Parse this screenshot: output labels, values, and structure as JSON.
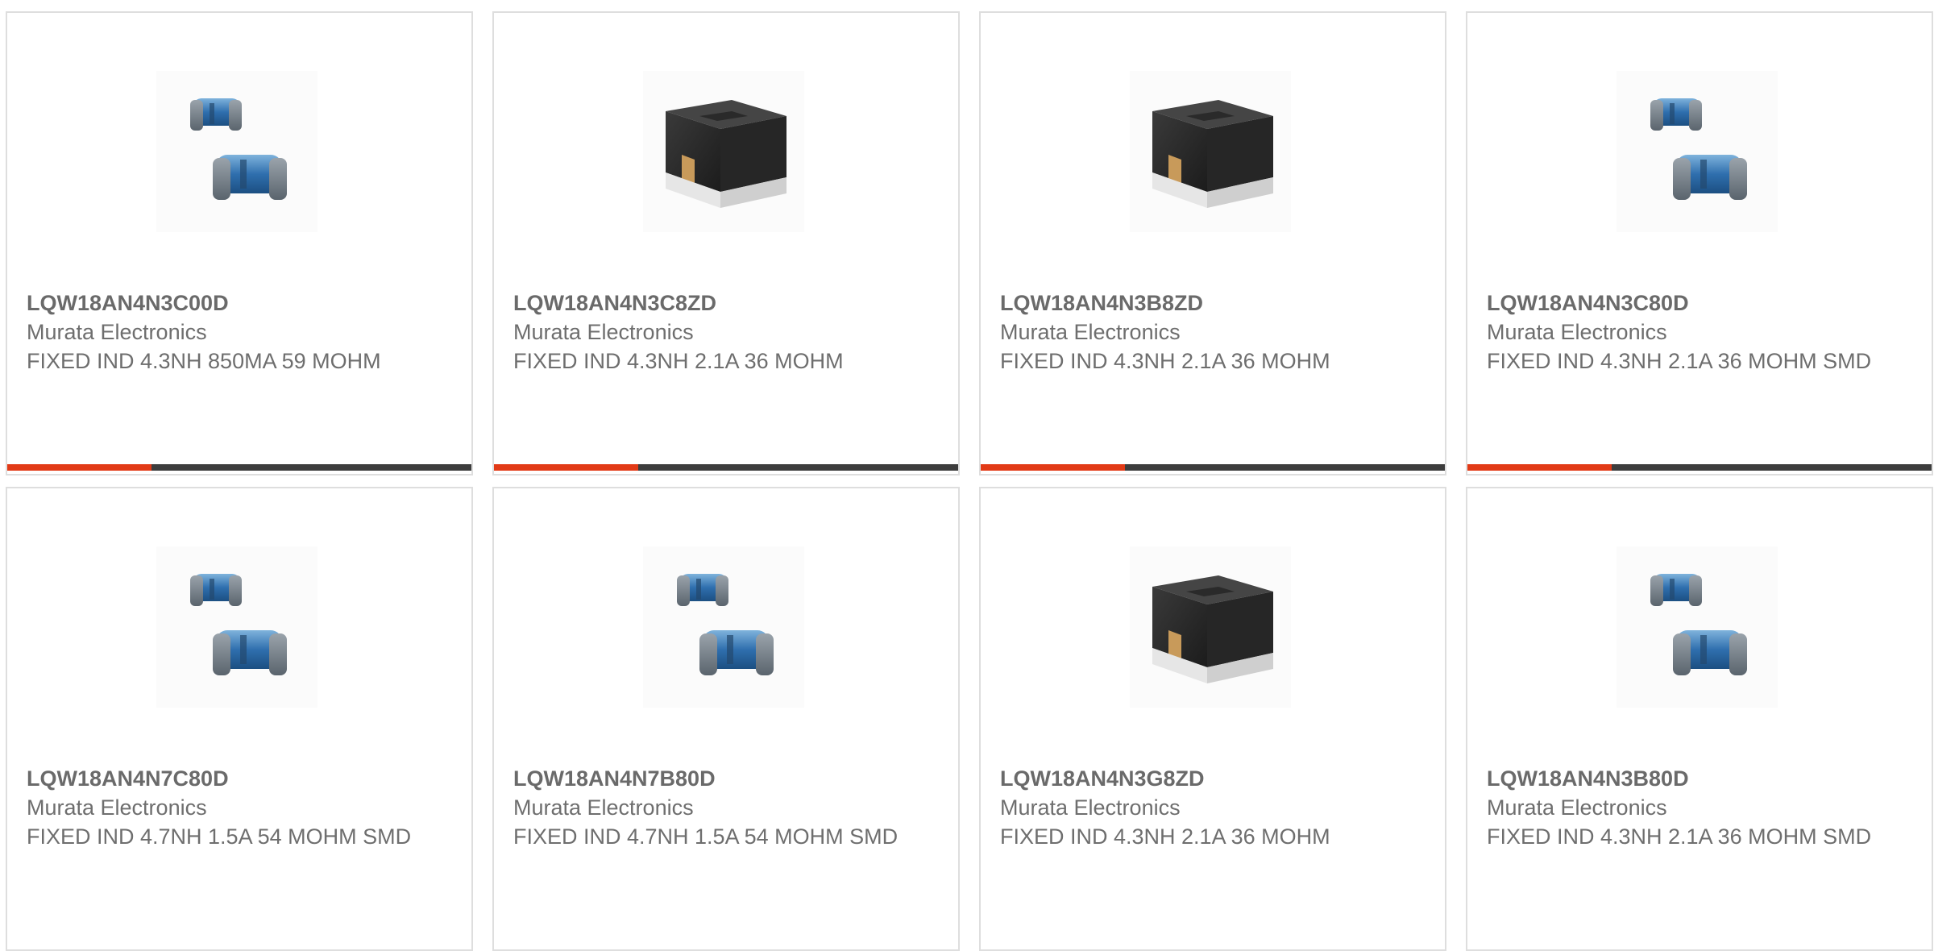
{
  "colors": {
    "card_border": "#dedede",
    "text": "#6e6e6e",
    "progress_fill": "#e23a16",
    "progress_track": "#3d3d3d"
  },
  "products": [
    {
      "part_number": "LQW18AN4N3C00D",
      "manufacturer": "Murata Electronics",
      "description": "FIXED IND 4.3NH 850MA 59 MOHM",
      "image_icon": "blue-wirewound-inductor-icon",
      "progress": 0.31
    },
    {
      "part_number": "LQW18AN4N3C8ZD",
      "manufacturer": "Murata Electronics",
      "description": "FIXED IND 4.3NH 2.1A 36 MOHM",
      "image_icon": "black-chip-inductor-icon",
      "progress": 0.31
    },
    {
      "part_number": "LQW18AN4N3B8ZD",
      "manufacturer": "Murata Electronics",
      "description": "FIXED IND 4.3NH 2.1A 36 MOHM",
      "image_icon": "black-chip-inductor-icon",
      "progress": 0.31
    },
    {
      "part_number": "LQW18AN4N3C80D",
      "manufacturer": "Murata Electronics",
      "description": "FIXED IND 4.3NH 2.1A 36 MOHM SMD",
      "image_icon": "blue-wirewound-inductor-icon",
      "progress": 0.31
    },
    {
      "part_number": "LQW18AN4N7C80D",
      "manufacturer": "Murata Electronics",
      "description": "FIXED IND 4.7NH 1.5A 54 MOHM SMD",
      "image_icon": "blue-wirewound-inductor-icon"
    },
    {
      "part_number": "LQW18AN4N7B80D",
      "manufacturer": "Murata Electronics",
      "description": "FIXED IND 4.7NH 1.5A 54 MOHM SMD",
      "image_icon": "blue-wirewound-inductor-icon"
    },
    {
      "part_number": "LQW18AN4N3G8ZD",
      "manufacturer": "Murata Electronics",
      "description": "FIXED IND 4.3NH 2.1A 36 MOHM",
      "image_icon": "black-chip-inductor-icon"
    },
    {
      "part_number": "LQW18AN4N3B80D",
      "manufacturer": "Murata Electronics",
      "description": "FIXED IND 4.3NH 2.1A 36 MOHM SMD",
      "image_icon": "blue-wirewound-inductor-icon"
    }
  ]
}
